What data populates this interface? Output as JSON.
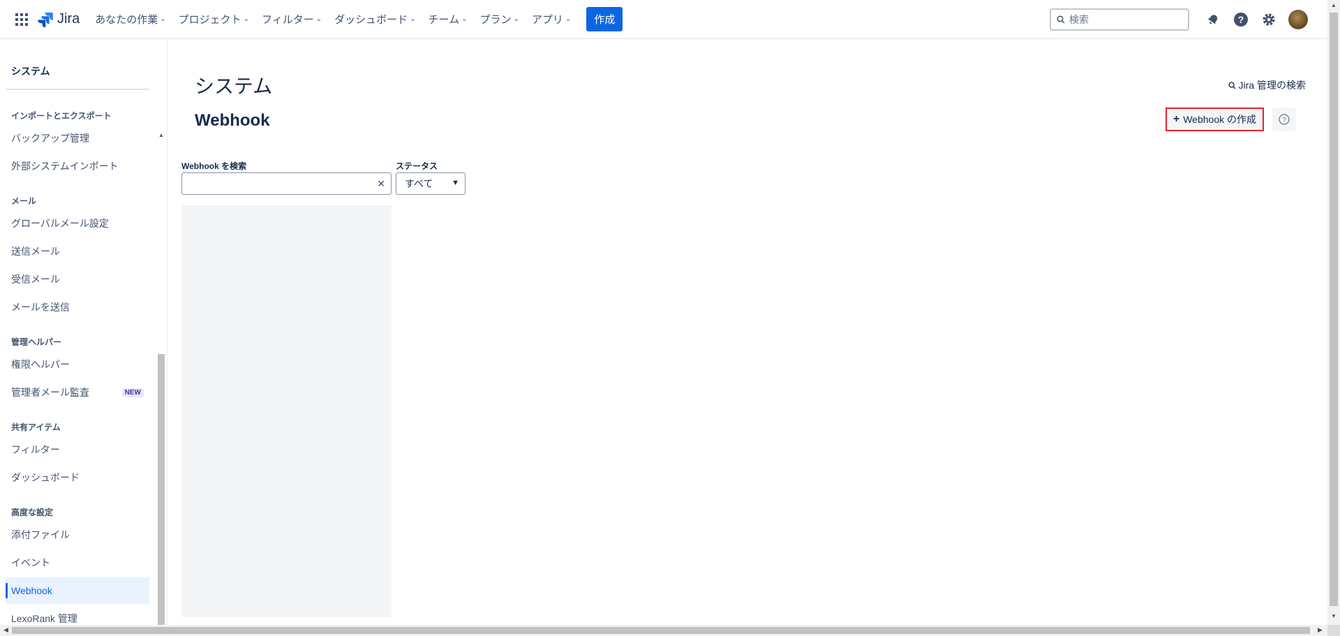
{
  "nav": {
    "logo_text": "Jira",
    "items": [
      {
        "label": "あなたの作業"
      },
      {
        "label": "プロジェクト"
      },
      {
        "label": "フィルター"
      },
      {
        "label": "ダッシュボード"
      },
      {
        "label": "チーム"
      },
      {
        "label": "プラン"
      },
      {
        "label": "アプリ"
      }
    ],
    "create_label": "作成",
    "search_placeholder": "検索",
    "icons": [
      "app-switcher-icon",
      "jira-logo",
      "notifications-icon",
      "help-icon",
      "settings-icon",
      "avatar"
    ],
    "accent_color": "#0c66e4"
  },
  "sidebar": {
    "title": "システム",
    "groups": [
      {
        "label": "インポートとエクスポート"
      },
      {
        "label": "メール"
      },
      {
        "label": "管理ヘルパー"
      },
      {
        "label": "共有アイテム"
      },
      {
        "label": "高度な設定"
      }
    ],
    "items": [
      {
        "label": "バックアップ管理"
      },
      {
        "label": "外部システムインポート"
      },
      {
        "label": "グローバルメール設定"
      },
      {
        "label": "送信メール"
      },
      {
        "label": "受信メール"
      },
      {
        "label": "メールを送信"
      },
      {
        "label": "権限ヘルパー"
      },
      {
        "label": "管理者メール監査",
        "badge": "NEW"
      },
      {
        "label": "フィルター"
      },
      {
        "label": "ダッシュボード"
      },
      {
        "label": "添付ファイル"
      },
      {
        "label": "イベント"
      },
      {
        "label": "Webhook",
        "active": true
      },
      {
        "label": "LexoRank 管理"
      }
    ]
  },
  "main": {
    "page_title": "システム",
    "admin_search_label": "Jira 管理の検索",
    "section_title": "Webhook",
    "create_button_label": "Webhook の作成",
    "search_label": "Webhook を検索",
    "search_value": "",
    "status_label": "ステータス",
    "status_value": "すべて",
    "highlight_color": "#e2232f"
  }
}
